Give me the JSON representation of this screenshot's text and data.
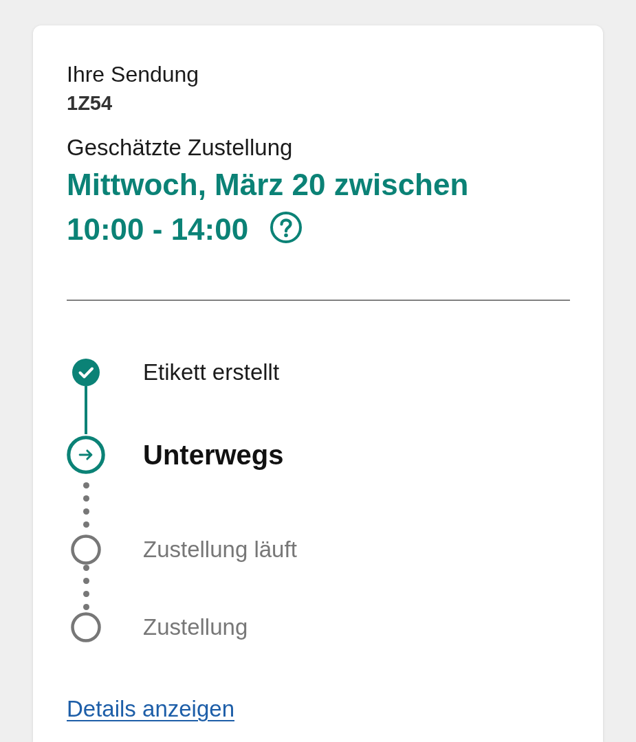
{
  "shipment": {
    "label": "Ihre Sendung",
    "tracking_number": "1Z54"
  },
  "delivery": {
    "label": "Geschätzte Zustellung",
    "estimate_lines": [
      "Mittwoch, März 20 zwischen",
      "10:00 - 14:00"
    ]
  },
  "steps": [
    {
      "label": "Etikett erstellt",
      "kind": "done"
    },
    {
      "label": "Unterwegs",
      "kind": "current"
    },
    {
      "label": "Zustellung läuft",
      "kind": "pending"
    },
    {
      "label": "Zustellung",
      "kind": "pending"
    }
  ],
  "details_link": "Details anzeigen"
}
